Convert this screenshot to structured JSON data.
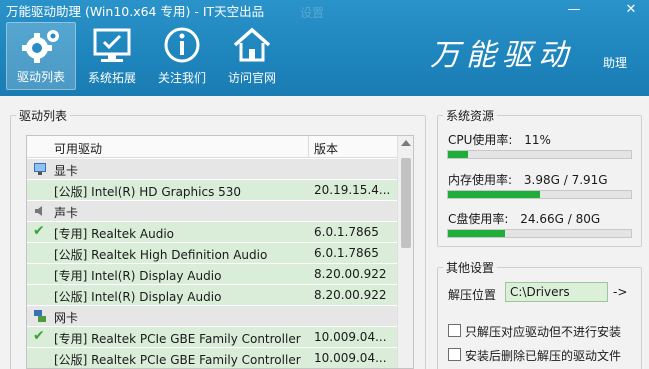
{
  "window": {
    "title": "万能驱动助理 (Win10.x64 专用) - IT天空出品",
    "ghost_text": "设置",
    "minimize_label": "—",
    "close_label": "✕"
  },
  "toolbar": [
    {
      "label": "驱动列表",
      "icon": "gear-icon",
      "active": true
    },
    {
      "label": "系统拓展",
      "icon": "monitor-icon",
      "active": false
    },
    {
      "label": "关注我们",
      "icon": "info-icon",
      "active": false
    },
    {
      "label": "访问官网",
      "icon": "home-icon",
      "active": false
    }
  ],
  "logo": {
    "text": "万能驱动",
    "sub": "助理"
  },
  "driver_panel": {
    "title": "驱动列表",
    "columns": {
      "name": "可用驱动",
      "version": "版本"
    },
    "rows": [
      {
        "type": "group",
        "label": "显卡",
        "icon": "display-icon"
      },
      {
        "type": "item",
        "name": "[公版] Intel(R) HD Graphics 530",
        "version": "20.19.15.4...",
        "checked": false
      },
      {
        "type": "group",
        "label": "声卡",
        "icon": "speaker-icon"
      },
      {
        "type": "item",
        "name": "[专用] Realtek Audio",
        "version": "6.0.1.7865",
        "checked": true
      },
      {
        "type": "item",
        "name": "[公版] Realtek High Definition Audio",
        "version": "6.0.1.7865",
        "checked": false
      },
      {
        "type": "item",
        "name": "[专用] Intel(R) Display Audio",
        "version": "8.20.00.922",
        "checked": false
      },
      {
        "type": "item",
        "name": "[公版] Intel(R) Display Audio",
        "version": "8.20.00.922",
        "checked": false
      },
      {
        "type": "group",
        "label": "网卡",
        "icon": "network-icon"
      },
      {
        "type": "item",
        "name": "[专用] Realtek PCIe GBE Family Controller",
        "version": "10.009.04...",
        "checked": true
      },
      {
        "type": "item",
        "name": "[公版] Realtek PCIe GBE Family Controller",
        "version": "10.009.04...",
        "checked": false
      }
    ]
  },
  "resources": {
    "title": "系统资源",
    "cpu": {
      "label": "CPU使用率:",
      "value": "11%",
      "fraction": 0.11
    },
    "memory": {
      "label": "内存使用率:",
      "value": "3.98G / 7.91G",
      "fraction": 0.5
    },
    "disk": {
      "label": "C盘使用率:",
      "value": "24.66G / 80G",
      "fraction": 0.31
    }
  },
  "settings": {
    "title": "其他设置",
    "extract_label": "解压位置",
    "extract_path": "C:\\Drivers",
    "browse_label": "->",
    "option1": "只解压对应驱动但不进行安装",
    "option2": "安装后删除已解压的驱动文件"
  },
  "colors": {
    "accent": "#2190c7",
    "progress": "#1fae3a",
    "row_highlight": "#d9edd9"
  }
}
